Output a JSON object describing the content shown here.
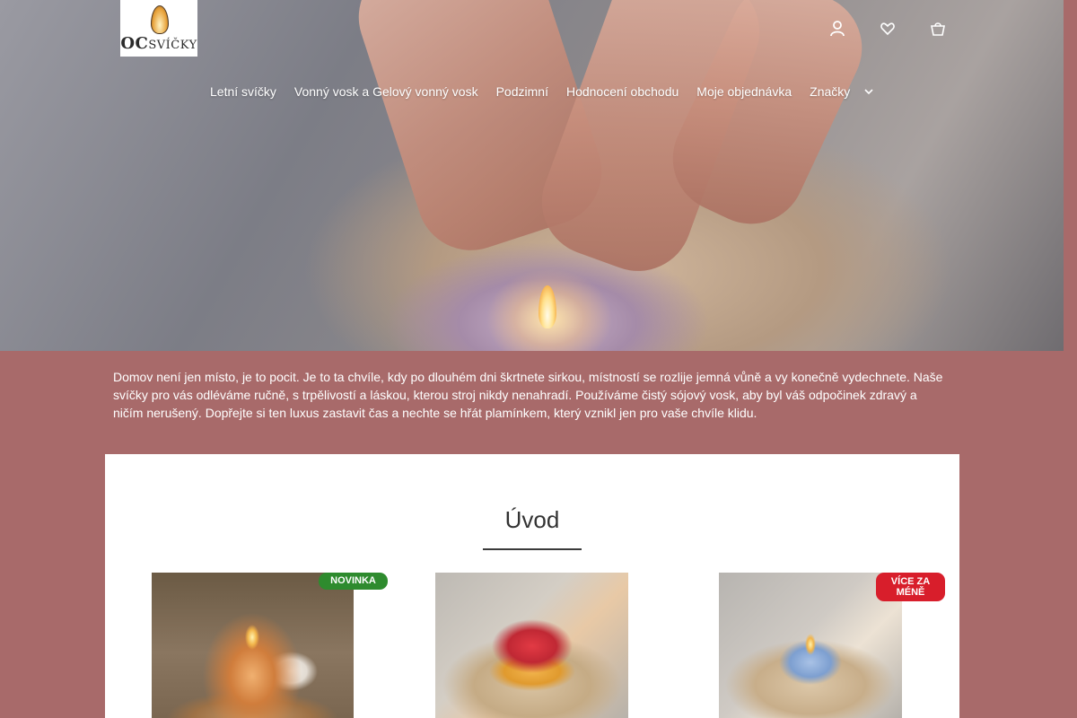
{
  "header": {
    "logo_text_initials": "OC",
    "logo_text_word": "SVÍČKY",
    "icons": [
      "user-icon",
      "heart-icon",
      "cart-icon"
    ]
  },
  "nav": {
    "items": [
      {
        "label": "Letní svíčky"
      },
      {
        "label": "Vonný vosk a Gelový vonný vosk"
      },
      {
        "label": "Podzimní"
      },
      {
        "label": "Hodnocení obchodu"
      },
      {
        "label": "Moje objednávka"
      },
      {
        "label": "Značky"
      }
    ],
    "more_icon": "chevron-down-icon"
  },
  "intro": {
    "text": "Domov není jen místo, je to pocit. Je to ta chvíle, kdy po dlouhém dni škrtnete sirkou, místností se rozlije jemná vůně a vy konečně vydechnete. Naše svíčky pro vás odléváme ručně, s trpělivostí a láskou, kterou stroj nikdy nenahradí. Používáme čistý sójový vosk, aby byl váš odpočinek zdravý a ničím nerušený. Dopřejte si ten luxus zastavit čas a nechte se hřát plamínkem, který vznikl jen pro vaše chvíle klidu."
  },
  "section": {
    "title": "Úvod"
  },
  "products": [
    {
      "badge": "NOVINKA"
    },
    {
      "badge": ""
    },
    {
      "badge_line1": "VÍCE ZA",
      "badge_line2": "MÉNĚ"
    }
  ],
  "colors": {
    "page_background": "#a86a6a",
    "badge_new": "#2e8b2e",
    "badge_sale": "#d81e2b",
    "text_light": "#ffffff"
  }
}
